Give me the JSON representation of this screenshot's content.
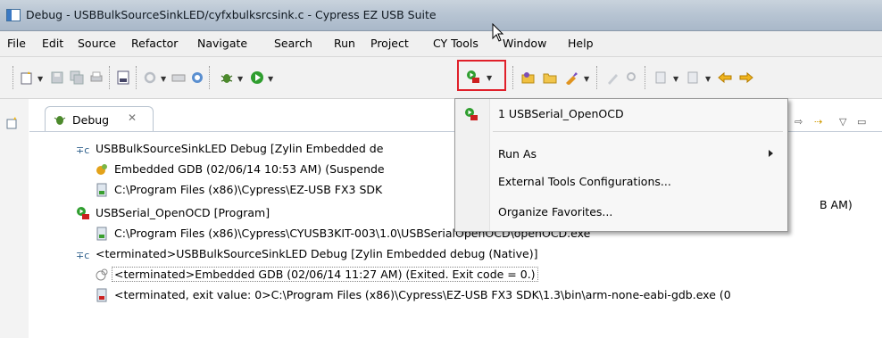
{
  "window": {
    "title": "Debug - USBBulkSourceSinkLED/cyfxbulksrcsink.c - Cypress EZ USB Suite"
  },
  "menubar": {
    "items": [
      "File",
      "Edit",
      "Source",
      "Refactor",
      "Navigate",
      "Search",
      "Run",
      "Project",
      "CY Tools",
      "Window",
      "Help"
    ]
  },
  "view": {
    "tab_label": "Debug",
    "close_glyph": "✕"
  },
  "tree": {
    "rows": [
      "USBBulkSourceSinkLED Debug [Zylin Embedded de",
      "Embedded GDB (02/06/14 10:53 AM) (Suspende",
      "C:\\Program Files (x86)\\Cypress\\EZ-USB FX3 SDK",
      "B AM)",
      "USBSerial_OpenOCD [Program]",
      "C:\\Program Files (x86)\\Cypress\\CYUSB3KIT-003\\1.0\\USBSerialOpenOCD\\openOCD.exe",
      "<terminated>USBBulkSourceSinkLED Debug [Zylin Embedded debug (Native)]",
      "<terminated>Embedded GDB (02/06/14 11:27 AM) (Exited. Exit code = 0.)",
      "<terminated, exit value: 0>C:\\Program Files (x86)\\Cypress\\EZ-USB FX3 SDK\\1.3\\bin\\arm-none-eabi-gdb.exe (0"
    ]
  },
  "run_menu": {
    "items": [
      {
        "label": "1 USBSerial_OpenOCD",
        "icon": "run-config-icon"
      },
      {
        "label": "Run As",
        "submenu": true
      },
      {
        "label": "External Tools Configurations..."
      },
      {
        "label": "Organize Favorites..."
      }
    ]
  },
  "colors": {
    "highlight_border": "#e0202a",
    "titlebar": "#b8c5d3",
    "menu_bg": "#f7f7f7"
  }
}
